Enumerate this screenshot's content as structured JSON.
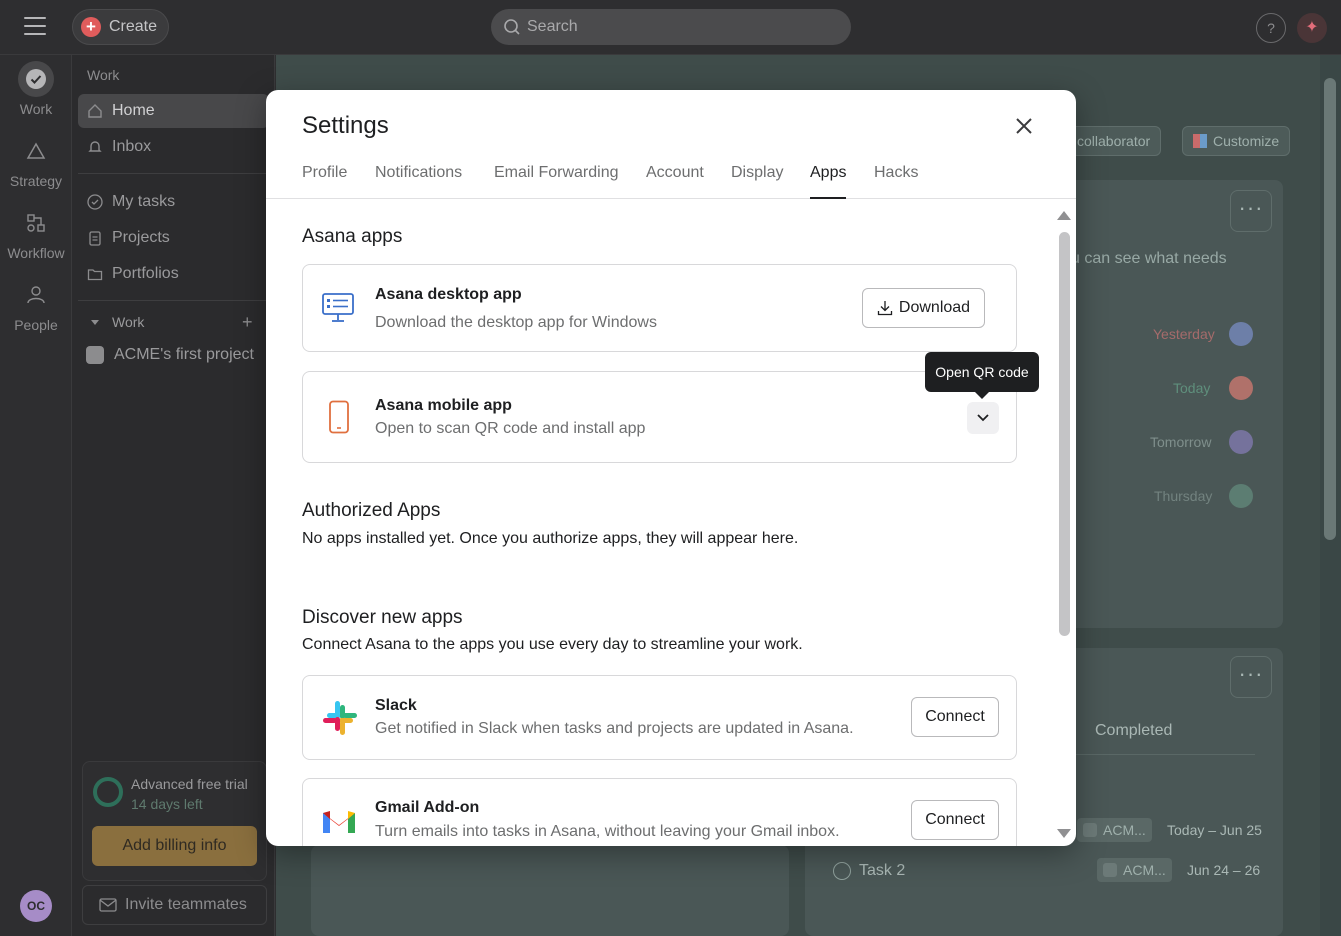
{
  "topbar": {
    "create_label": "Create",
    "search_placeholder": "Search",
    "help_label": "?"
  },
  "rail": {
    "items": [
      {
        "label": "Work",
        "icon": "check-circle-icon"
      },
      {
        "label": "Strategy",
        "icon": "triangle-icon"
      },
      {
        "label": "Workflow",
        "icon": "workflow-icon"
      },
      {
        "label": "People",
        "icon": "people-icon"
      }
    ],
    "avatar_initials": "OC"
  },
  "sidebar": {
    "section_label": "Work",
    "items": [
      {
        "label": "Home",
        "icon": "home-icon"
      },
      {
        "label": "Inbox",
        "icon": "bell-icon"
      },
      {
        "label": "My tasks",
        "icon": "check-circle-icon"
      },
      {
        "label": "Projects",
        "icon": "clipboard-icon"
      },
      {
        "label": "Portfolios",
        "icon": "folder-icon"
      }
    ],
    "group_label": "Work",
    "project_label": "ACME's first project",
    "trial_title": "Advanced free trial",
    "trial_sub": "14 days left",
    "billing_label": "Add billing info",
    "invite_label": "Invite teammates"
  },
  "background": {
    "collaborator_label": "collaborator",
    "customize_label": "Customize",
    "snippet": "u can see what needs",
    "due_dates": [
      "Yesterday",
      "Today",
      "Tomorrow",
      "Thursday"
    ],
    "completed_label": "Completed",
    "tasks": [
      {
        "chip": "ACM...",
        "date": "Today – Jun 25"
      },
      {
        "name": "Task 2",
        "chip": "ACM...",
        "date": "Jun 24 – 26"
      }
    ]
  },
  "modal": {
    "title": "Settings",
    "tabs": [
      "Profile",
      "Notifications",
      "Email Forwarding",
      "Account",
      "Display",
      "Apps",
      "Hacks"
    ],
    "active_tab": "Apps",
    "asana_apps": {
      "title": "Asana apps",
      "desktop": {
        "name": "Asana desktop app",
        "desc": "Download the desktop app for Windows",
        "button": "Download"
      },
      "mobile": {
        "name": "Asana mobile app",
        "desc": "Open to scan QR code and install app",
        "tooltip": "Open QR code"
      }
    },
    "authorized": {
      "title": "Authorized Apps",
      "desc": "No apps installed yet. Once you authorize apps, they will appear here."
    },
    "discover": {
      "title": "Discover new apps",
      "desc": "Connect Asana to the apps you use every day to streamline your work.",
      "apps": [
        {
          "name": "Slack",
          "desc": "Get notified in Slack when tasks and projects are updated in Asana.",
          "button": "Connect"
        },
        {
          "name": "Gmail Add-on",
          "desc": "Turn emails into tasks in Asana, without leaving your Gmail inbox.",
          "button": "Connect"
        }
      ]
    }
  }
}
